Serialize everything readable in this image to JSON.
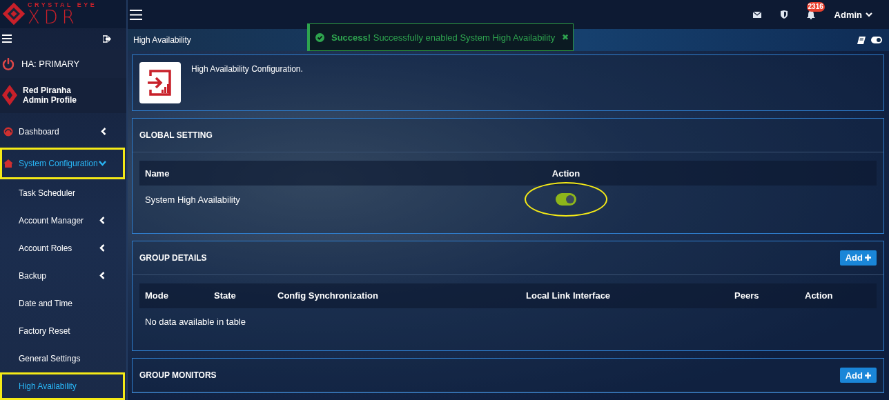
{
  "logo": {
    "top": "CRYSTAL EYE",
    "bottom": "XDR"
  },
  "topbar": {
    "notifications": "2316",
    "user": "Admin"
  },
  "sidebar": {
    "ha_status": "HA: PRIMARY",
    "profile": {
      "name": "Red Piranha",
      "role": "Admin Profile"
    },
    "items": [
      {
        "label": "Dashboard",
        "kind": "section",
        "expanded": false,
        "selected": false,
        "highlighted": false
      },
      {
        "label": "System Configuration",
        "kind": "section",
        "expanded": true,
        "selected": true,
        "highlighted": true
      },
      {
        "label": "Task Scheduler",
        "kind": "sub",
        "selected": false,
        "highlighted": false
      },
      {
        "label": "Account Manager",
        "kind": "subgroup",
        "expanded": false,
        "selected": false,
        "highlighted": false
      },
      {
        "label": "Account Roles",
        "kind": "subgroup",
        "expanded": false,
        "selected": false,
        "highlighted": false
      },
      {
        "label": "Backup",
        "kind": "subgroup",
        "expanded": false,
        "selected": false,
        "highlighted": false
      },
      {
        "label": "Date and Time",
        "kind": "sub",
        "selected": false,
        "highlighted": false
      },
      {
        "label": "Factory Reset",
        "kind": "sub",
        "selected": false,
        "highlighted": false
      },
      {
        "label": "General Settings",
        "kind": "sub",
        "selected": false,
        "highlighted": false
      },
      {
        "label": "High Availability",
        "kind": "sub",
        "selected": true,
        "highlighted": true
      }
    ]
  },
  "breadcrumb": "High Availability",
  "toast": {
    "title": "Success!",
    "message": "Successfully enabled System High Availability",
    "close": "✖"
  },
  "intro": "High Availability Configuration.",
  "global_setting": {
    "title": "GLOBAL SETTING",
    "columns": [
      "Name",
      "Action"
    ],
    "rows": [
      {
        "name": "System High Availability",
        "on": true,
        "highlighted": true
      }
    ]
  },
  "group_details": {
    "title": "GROUP DETAILS",
    "button": "Add",
    "columns": [
      "Mode",
      "State",
      "Config Synchronization",
      "Local Link Interface",
      "Peers",
      "Action"
    ],
    "empty": "No data available in table"
  },
  "group_monitors": {
    "title": "GROUP MONITORS",
    "button": "Add"
  }
}
